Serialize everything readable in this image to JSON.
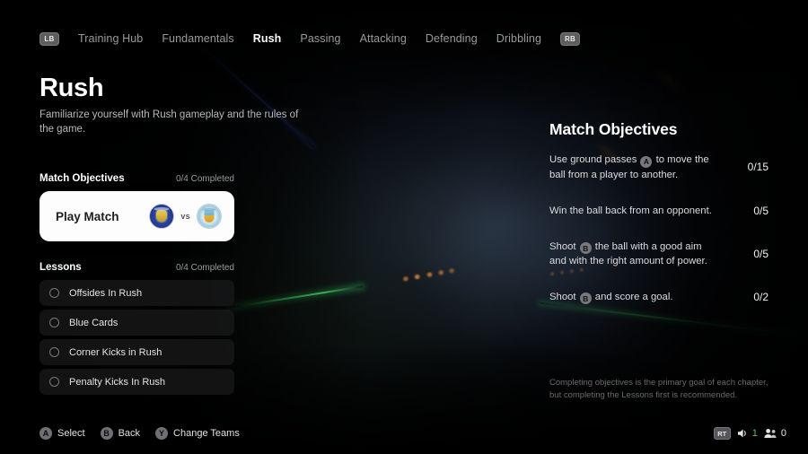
{
  "topnav": {
    "left_bumper": "LB",
    "right_bumper": "RB",
    "items": [
      {
        "label": "Training Hub",
        "active": false
      },
      {
        "label": "Fundamentals",
        "active": false
      },
      {
        "label": "Rush",
        "active": true
      },
      {
        "label": "Passing",
        "active": false
      },
      {
        "label": "Attacking",
        "active": false
      },
      {
        "label": "Defending",
        "active": false
      },
      {
        "label": "Dribbling",
        "active": false
      }
    ]
  },
  "page": {
    "title": "Rush",
    "subtitle": "Familiarize yourself with Rush gameplay and the rules of the game."
  },
  "match_objectives_section": {
    "title": "Match Objectives",
    "completed": "0/4 Completed",
    "card": {
      "label": "Play Match",
      "home_team": "Chelsea",
      "vs": "vs",
      "away_team": "Manchester City"
    }
  },
  "lessons_section": {
    "title": "Lessons",
    "completed": "0/4 Completed",
    "items": [
      {
        "label": "Offsides In Rush",
        "completed": false
      },
      {
        "label": "Blue Cards",
        "completed": false
      },
      {
        "label": "Corner Kicks in Rush",
        "completed": false
      },
      {
        "label": "Penalty Kicks In Rush",
        "completed": false
      }
    ]
  },
  "objectives_panel": {
    "title": "Match Objectives",
    "items": [
      {
        "text_before": "Use ground passes ",
        "button": "A",
        "text_after": " to move the ball from a player to another.",
        "count": "0/15"
      },
      {
        "text_before": "Win the ball back from an opponent.",
        "button": "",
        "text_after": "",
        "count": "0/5"
      },
      {
        "text_before": "Shoot ",
        "button": "B",
        "text_after": " the ball with a good aim and with the right amount of power.",
        "count": "0/5"
      },
      {
        "text_before": "Shoot ",
        "button": "B",
        "text_after": " and score a goal.",
        "count": "0/2"
      }
    ],
    "note": "Completing objectives is the primary goal of each chapter, but completing the Lessons first is recommended."
  },
  "prompts": [
    {
      "glyph": "A",
      "label": "Select"
    },
    {
      "glyph": "B",
      "label": "Back"
    },
    {
      "glyph": "Y",
      "label": "Change Teams"
    }
  ],
  "hud": {
    "trigger": "RT",
    "volume_value": "1",
    "players_value": "0"
  },
  "colors": {
    "accent_green": "#57c46a",
    "card_white": "#fdfdfd",
    "text_primary": "#ffffff",
    "text_muted": "#9a9a9d"
  }
}
